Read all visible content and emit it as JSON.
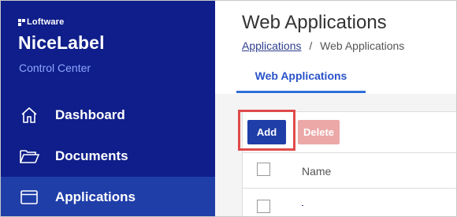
{
  "brand": {
    "company": "Loftware",
    "product": "NiceLabel",
    "subtitle": "Control Center"
  },
  "sidebar": {
    "items": [
      {
        "label": "Dashboard",
        "icon": "home-icon",
        "active": false
      },
      {
        "label": "Documents",
        "icon": "folder-icon",
        "active": false
      },
      {
        "label": "Applications",
        "icon": "window-icon",
        "active": true
      }
    ]
  },
  "header": {
    "title": "Web Applications",
    "breadcrumb": {
      "parent": "Applications",
      "separator": "/",
      "current": "Web Applications"
    }
  },
  "tabs": [
    {
      "label": "Web Applications",
      "active": true
    }
  ],
  "toolbar": {
    "add_label": "Add",
    "delete_label": "Delete"
  },
  "table": {
    "columns": [
      "Name"
    ],
    "rows": [
      {
        "name": ""
      }
    ]
  },
  "colors": {
    "sidebar_bg": "#0f1e8a",
    "sidebar_active": "#1f3ea8",
    "accent": "#2952c9",
    "add_button": "#1f3ea8",
    "delete_disabled": "#eca7a7",
    "highlight": "#e04a4a"
  }
}
